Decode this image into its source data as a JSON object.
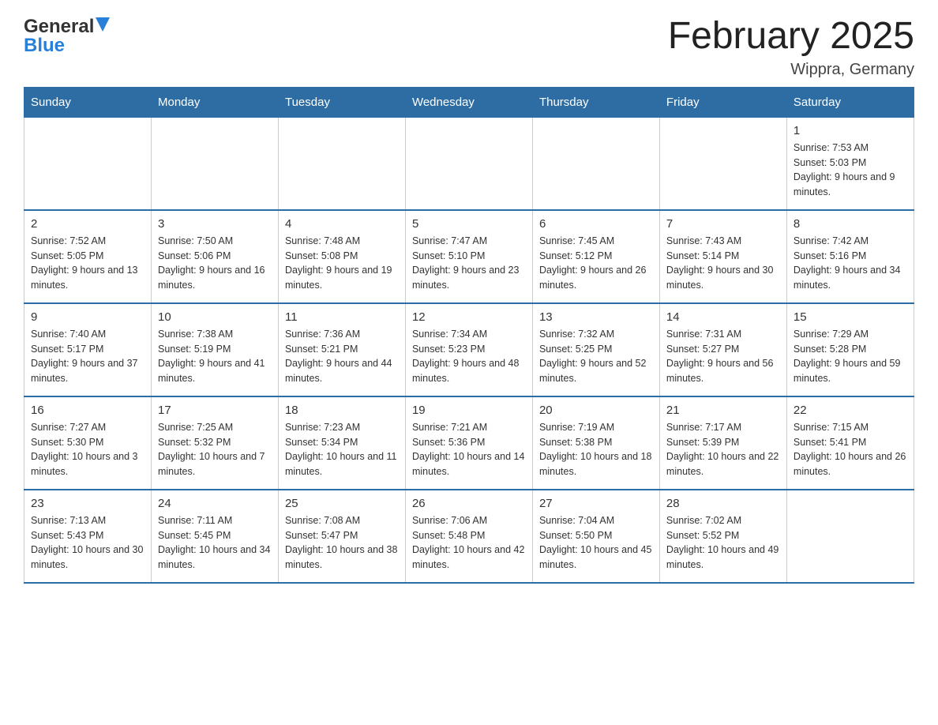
{
  "header": {
    "title": "February 2025",
    "subtitle": "Wippra, Germany"
  },
  "logo": {
    "line1": "General",
    "line2": "Blue"
  },
  "days_of_week": [
    "Sunday",
    "Monday",
    "Tuesday",
    "Wednesday",
    "Thursday",
    "Friday",
    "Saturday"
  ],
  "weeks": [
    {
      "days": [
        {
          "number": "",
          "info": ""
        },
        {
          "number": "",
          "info": ""
        },
        {
          "number": "",
          "info": ""
        },
        {
          "number": "",
          "info": ""
        },
        {
          "number": "",
          "info": ""
        },
        {
          "number": "",
          "info": ""
        },
        {
          "number": "1",
          "info": "Sunrise: 7:53 AM\nSunset: 5:03 PM\nDaylight: 9 hours and 9 minutes."
        }
      ]
    },
    {
      "days": [
        {
          "number": "2",
          "info": "Sunrise: 7:52 AM\nSunset: 5:05 PM\nDaylight: 9 hours and 13 minutes."
        },
        {
          "number": "3",
          "info": "Sunrise: 7:50 AM\nSunset: 5:06 PM\nDaylight: 9 hours and 16 minutes."
        },
        {
          "number": "4",
          "info": "Sunrise: 7:48 AM\nSunset: 5:08 PM\nDaylight: 9 hours and 19 minutes."
        },
        {
          "number": "5",
          "info": "Sunrise: 7:47 AM\nSunset: 5:10 PM\nDaylight: 9 hours and 23 minutes."
        },
        {
          "number": "6",
          "info": "Sunrise: 7:45 AM\nSunset: 5:12 PM\nDaylight: 9 hours and 26 minutes."
        },
        {
          "number": "7",
          "info": "Sunrise: 7:43 AM\nSunset: 5:14 PM\nDaylight: 9 hours and 30 minutes."
        },
        {
          "number": "8",
          "info": "Sunrise: 7:42 AM\nSunset: 5:16 PM\nDaylight: 9 hours and 34 minutes."
        }
      ]
    },
    {
      "days": [
        {
          "number": "9",
          "info": "Sunrise: 7:40 AM\nSunset: 5:17 PM\nDaylight: 9 hours and 37 minutes."
        },
        {
          "number": "10",
          "info": "Sunrise: 7:38 AM\nSunset: 5:19 PM\nDaylight: 9 hours and 41 minutes."
        },
        {
          "number": "11",
          "info": "Sunrise: 7:36 AM\nSunset: 5:21 PM\nDaylight: 9 hours and 44 minutes."
        },
        {
          "number": "12",
          "info": "Sunrise: 7:34 AM\nSunset: 5:23 PM\nDaylight: 9 hours and 48 minutes."
        },
        {
          "number": "13",
          "info": "Sunrise: 7:32 AM\nSunset: 5:25 PM\nDaylight: 9 hours and 52 minutes."
        },
        {
          "number": "14",
          "info": "Sunrise: 7:31 AM\nSunset: 5:27 PM\nDaylight: 9 hours and 56 minutes."
        },
        {
          "number": "15",
          "info": "Sunrise: 7:29 AM\nSunset: 5:28 PM\nDaylight: 9 hours and 59 minutes."
        }
      ]
    },
    {
      "days": [
        {
          "number": "16",
          "info": "Sunrise: 7:27 AM\nSunset: 5:30 PM\nDaylight: 10 hours and 3 minutes."
        },
        {
          "number": "17",
          "info": "Sunrise: 7:25 AM\nSunset: 5:32 PM\nDaylight: 10 hours and 7 minutes."
        },
        {
          "number": "18",
          "info": "Sunrise: 7:23 AM\nSunset: 5:34 PM\nDaylight: 10 hours and 11 minutes."
        },
        {
          "number": "19",
          "info": "Sunrise: 7:21 AM\nSunset: 5:36 PM\nDaylight: 10 hours and 14 minutes."
        },
        {
          "number": "20",
          "info": "Sunrise: 7:19 AM\nSunset: 5:38 PM\nDaylight: 10 hours and 18 minutes."
        },
        {
          "number": "21",
          "info": "Sunrise: 7:17 AM\nSunset: 5:39 PM\nDaylight: 10 hours and 22 minutes."
        },
        {
          "number": "22",
          "info": "Sunrise: 7:15 AM\nSunset: 5:41 PM\nDaylight: 10 hours and 26 minutes."
        }
      ]
    },
    {
      "days": [
        {
          "number": "23",
          "info": "Sunrise: 7:13 AM\nSunset: 5:43 PM\nDaylight: 10 hours and 30 minutes."
        },
        {
          "number": "24",
          "info": "Sunrise: 7:11 AM\nSunset: 5:45 PM\nDaylight: 10 hours and 34 minutes."
        },
        {
          "number": "25",
          "info": "Sunrise: 7:08 AM\nSunset: 5:47 PM\nDaylight: 10 hours and 38 minutes."
        },
        {
          "number": "26",
          "info": "Sunrise: 7:06 AM\nSunset: 5:48 PM\nDaylight: 10 hours and 42 minutes."
        },
        {
          "number": "27",
          "info": "Sunrise: 7:04 AM\nSunset: 5:50 PM\nDaylight: 10 hours and 45 minutes."
        },
        {
          "number": "28",
          "info": "Sunrise: 7:02 AM\nSunset: 5:52 PM\nDaylight: 10 hours and 49 minutes."
        },
        {
          "number": "",
          "info": ""
        }
      ]
    }
  ]
}
